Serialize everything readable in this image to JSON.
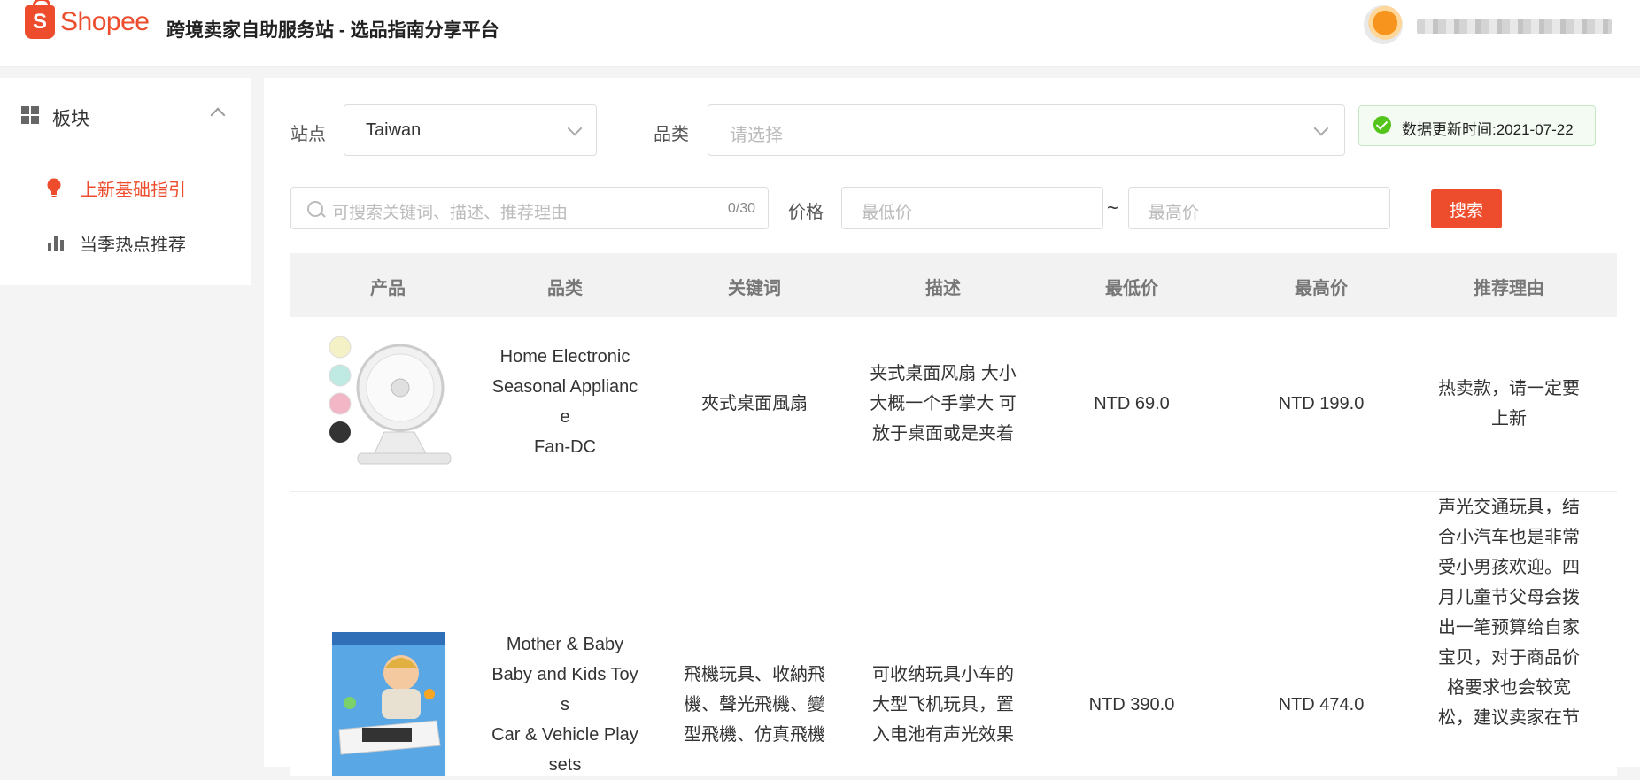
{
  "header": {
    "logo_text": "Shopee",
    "logo_letter": "S",
    "title": "跨境卖家自助服务站 - 选品指南分享平台"
  },
  "sidebar": {
    "section_label": "板块",
    "items": [
      {
        "label": "上新基础指引",
        "active": true
      },
      {
        "label": "当季热点推荐",
        "active": false
      }
    ]
  },
  "filters": {
    "site_label": "站点",
    "site_value": "Taiwan",
    "category_label": "品类",
    "category_placeholder": "请选择",
    "update_text": "数据更新时间:2021-07-22",
    "search_placeholder": "可搜索关键词、描述、推荐理由",
    "search_counter": "0/30",
    "price_label": "价格",
    "min_placeholder": "最低价",
    "tilde": "~",
    "max_placeholder": "最高价",
    "search_button": "搜索"
  },
  "table": {
    "columns": [
      "产品",
      "品类",
      "关键词",
      "描述",
      "最低价",
      "最高价",
      "推荐理由"
    ],
    "rows": [
      {
        "category": [
          "Home Electronic",
          "Seasonal Applianc",
          "e",
          "Fan-DC"
        ],
        "keywords": [
          "夾式桌面風扇"
        ],
        "description": [
          "夹式桌面风扇 大小",
          "大概一个手掌大 可",
          "放于桌面或是夹着"
        ],
        "min_price": "NTD 69.0",
        "max_price": "NTD 199.0",
        "reason": [
          "热卖款，请一定要",
          "上新"
        ]
      },
      {
        "category": [
          "Mother & Baby",
          "Baby and Kids Toy",
          "s",
          "Car & Vehicle Play",
          "sets"
        ],
        "keywords": [
          "飛機玩具、收納飛",
          "機、聲光飛機、變",
          "型飛機、仿真飛機"
        ],
        "description": [
          "可收纳玩具小车的",
          "大型飞机玩具，置",
          "入电池有声光效果"
        ],
        "min_price": "NTD 390.0",
        "max_price": "NTD 474.0",
        "reason": [
          "声光交通玩具，结",
          "合小汽车也是非常",
          "受小男孩欢迎。四",
          "月儿童节父母会拨",
          "出一笔预算给自家",
          "宝贝，对于商品价",
          "格要求也会较宽",
          "松，建议卖家在节"
        ]
      }
    ]
  },
  "colors": {
    "brand": "#ee4d2d",
    "success": "#52c41a"
  }
}
